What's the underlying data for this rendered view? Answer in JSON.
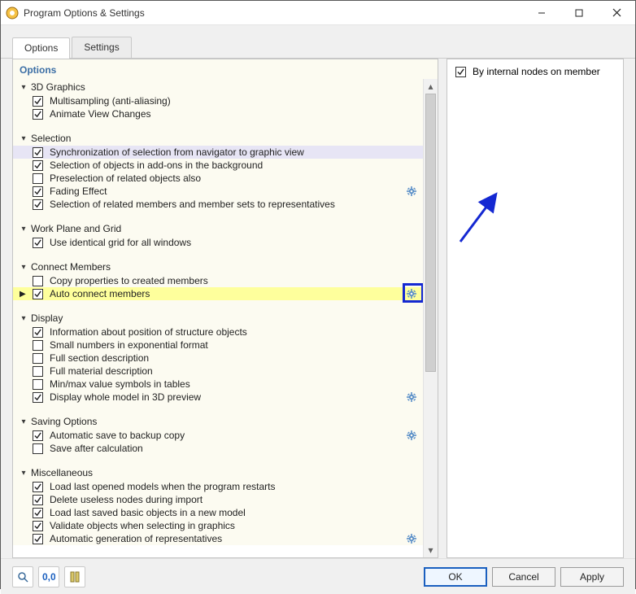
{
  "window": {
    "title": "Program Options & Settings"
  },
  "tabs": {
    "options": "Options",
    "settings": "Settings"
  },
  "left_panel": {
    "heading": "Options",
    "groups": [
      {
        "title": "3D Graphics",
        "items": [
          {
            "label": "Multisampling (anti-aliasing)",
            "checked": true
          },
          {
            "label": "Animate View Changes",
            "checked": true
          }
        ]
      },
      {
        "title": "Selection",
        "items": [
          {
            "label": "Synchronization of selection from navigator to graphic view",
            "checked": true,
            "selected": true
          },
          {
            "label": "Selection of objects in add-ons in the background",
            "checked": true
          },
          {
            "label": "Preselection of related objects also",
            "checked": false
          },
          {
            "label": "Fading Effect",
            "checked": true,
            "gear": true
          },
          {
            "label": "Selection of related members and member sets to representatives",
            "checked": true
          }
        ]
      },
      {
        "title": "Work Plane and Grid",
        "items": [
          {
            "label": "Use identical grid for all windows",
            "checked": true
          }
        ]
      },
      {
        "title": "Connect Members",
        "items": [
          {
            "label": "Copy properties to created members",
            "checked": false
          },
          {
            "label": "Auto connect members",
            "checked": true,
            "highlight": true,
            "gear": true,
            "gear_focus": true
          }
        ]
      },
      {
        "title": "Display",
        "items": [
          {
            "label": "Information about position of structure objects",
            "checked": true
          },
          {
            "label": "Small numbers in exponential format",
            "checked": false
          },
          {
            "label": "Full section description",
            "checked": false
          },
          {
            "label": "Full material description",
            "checked": false
          },
          {
            "label": "Min/max value symbols in tables",
            "checked": false
          },
          {
            "label": "Display whole model in 3D preview",
            "checked": true,
            "gear": true
          }
        ]
      },
      {
        "title": "Saving Options",
        "items": [
          {
            "label": "Automatic save to backup copy",
            "checked": true,
            "gear": true
          },
          {
            "label": "Save after calculation",
            "checked": false
          }
        ]
      },
      {
        "title": "Miscellaneous",
        "items": [
          {
            "label": "Load last opened models when the program restarts",
            "checked": true
          },
          {
            "label": "Delete useless nodes during import",
            "checked": true
          },
          {
            "label": "Load last saved basic objects in a new model",
            "checked": true
          },
          {
            "label": "Validate objects when selecting in graphics",
            "checked": true
          },
          {
            "label": "Automatic generation of representatives",
            "checked": true,
            "gear": true
          }
        ]
      }
    ]
  },
  "right_panel": {
    "option_label": "By internal nodes on member",
    "option_checked": true
  },
  "footer": {
    "ok": "OK",
    "cancel": "Cancel",
    "apply": "Apply"
  },
  "icons": {
    "gear_color": "#5a8fc8"
  }
}
